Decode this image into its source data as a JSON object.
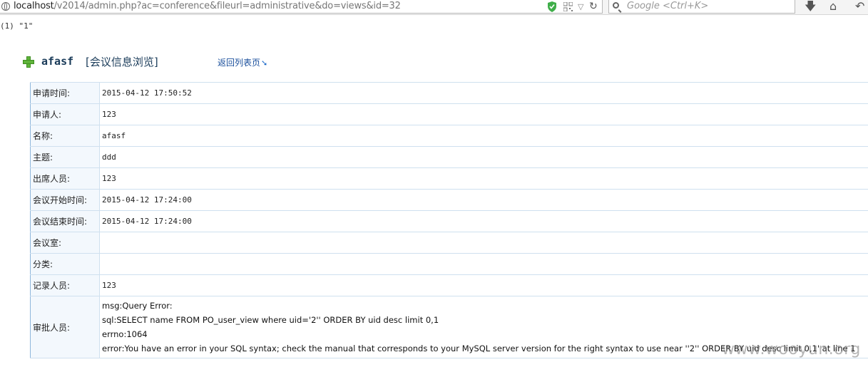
{
  "browser": {
    "url_host": "localhost",
    "url_path": "/v2014/admin.php?ac=conference&fileurl=administrative&do=views&id=32",
    "search_placeholder": "Google <Ctrl+K>"
  },
  "debug_output": "(1) \"1\"",
  "header": {
    "title": "afasf",
    "subtitle": "[会议信息浏览]",
    "back_link": "返回列表页"
  },
  "rows": [
    {
      "label": "申请时间:",
      "value": "2015-04-12 17:50:52"
    },
    {
      "label": "申请人:",
      "value": "123"
    },
    {
      "label": "名称:",
      "value": "afasf"
    },
    {
      "label": "主题:",
      "value": "ddd"
    },
    {
      "label": "出席人员:",
      "value": "123"
    },
    {
      "label": "会议开始时间:",
      "value": "2015-04-12 17:24:00"
    },
    {
      "label": "会议结束时间:",
      "value": "2015-04-12 17:24:00"
    },
    {
      "label": "会议室:",
      "value": ""
    },
    {
      "label": "分类:",
      "value": ""
    },
    {
      "label": "记录人员:",
      "value": "123"
    }
  ],
  "approver": {
    "label": "审批人员:",
    "lines": [
      "msg:Query Error:",
      "sql:SELECT name FROM PO_user_view where uid='2'' ORDER BY uid desc limit 0,1",
      "errno:1064",
      "error:You have an error in your SQL syntax; check the manual that corresponds to your MySQL server version for the right syntax to use near ''2'' ORDER BY uid desc limit 0,1' at line 1"
    ]
  },
  "watermark": "www.wooyun.org"
}
